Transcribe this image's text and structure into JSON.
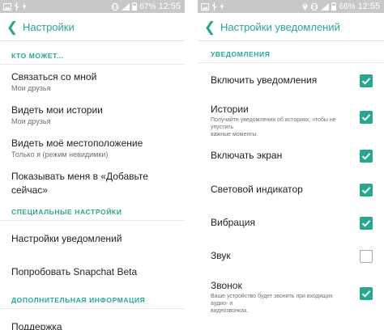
{
  "left": {
    "status": {
      "percent": "67%",
      "time": "12:55"
    },
    "title": "Настройки",
    "sections": {
      "who_can": "КТО МОЖЕТ...",
      "special": "СПЕЦИАЛЬНЫЕ НАСТРОЙКИ",
      "additional": "ДОПОЛНИТЕЛЬНАЯ ИНФОРМАЦИЯ"
    },
    "items": {
      "contact": {
        "title": "Связаться со мной",
        "sub": "Мои друзья"
      },
      "stories": {
        "title": "Видеть мои истории",
        "sub": "Мои друзья"
      },
      "location": {
        "title": "Видеть моё местоположение",
        "sub": "Только я (режим невидимки)"
      },
      "quick_add": {
        "title_line1": "Показывать меня в «Добавьте",
        "title_line2": "сейчас»"
      },
      "notifications": {
        "title": "Настройки уведомлений"
      },
      "beta": {
        "title": "Попробовать Snapchat Beta"
      },
      "support": {
        "title": "Поддержка"
      }
    }
  },
  "right": {
    "status": {
      "percent": "66%",
      "time": "12:55"
    },
    "title": "Настройки уведомлений",
    "section": "УВЕДОМЛЕНИЯ",
    "items": [
      {
        "title": "Включить уведомления",
        "desc1": "",
        "desc2": "",
        "checked": true
      },
      {
        "title": "Истории",
        "desc1": "Получайте уведомления об историях, чтобы не упустить",
        "desc2": "важные моменты.",
        "checked": true
      },
      {
        "title": "Включать экран",
        "desc1": "",
        "desc2": "",
        "checked": true
      },
      {
        "title": "Световой индикатор",
        "desc1": "",
        "desc2": "",
        "checked": true
      },
      {
        "title": "Вибрация",
        "desc1": "",
        "desc2": "",
        "checked": true
      },
      {
        "title": "Звук",
        "desc1": "",
        "desc2": "",
        "checked": false
      },
      {
        "title": "Звонок",
        "desc1": "Ваше устройство будет звонить при входящих аудио- и",
        "desc2": "видеозвонках.",
        "checked": true
      }
    ]
  },
  "colors": {
    "accent": "#27a691",
    "statusbar": "#c8c8c8",
    "text": "#222222",
    "subtext": "#6f6f6f"
  }
}
